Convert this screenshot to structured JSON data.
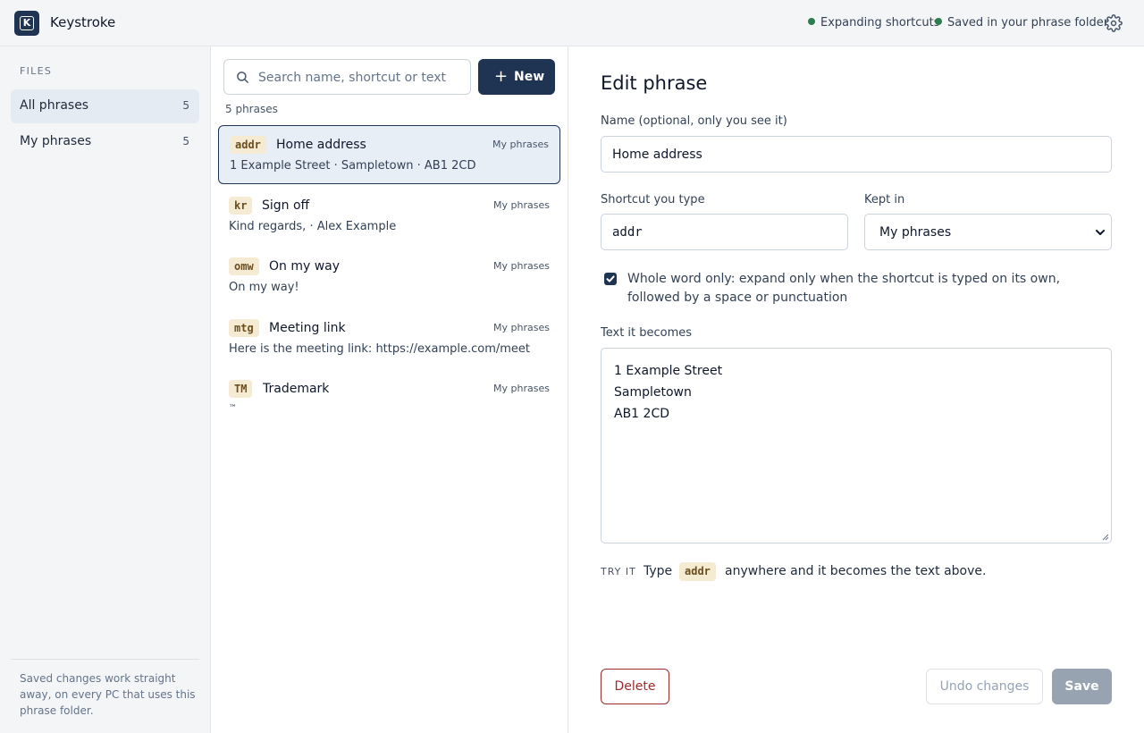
{
  "app": {
    "title": "Keystroke",
    "logo_letter": "K"
  },
  "status": {
    "expanding": "Expanding shortcuts",
    "saved": "Saved in your phrase folder",
    "dot_color": "#2f7d4f"
  },
  "sidebar": {
    "heading": "FILES",
    "items": [
      {
        "label": "All phrases",
        "count": "5",
        "active": true
      },
      {
        "label": "My phrases",
        "count": "5",
        "active": false
      }
    ],
    "note": "Saved changes work straight away, on every PC that uses this phrase folder."
  },
  "list": {
    "search_placeholder": "Search name, shortcut or text",
    "new_label": "New",
    "count_text": "5 phrases",
    "items": [
      {
        "code": "addr",
        "name": "Home address",
        "folder": "My phrases",
        "preview": "1 Example Street · Sampletown · AB1 2CD",
        "selected": true
      },
      {
        "code": "kr",
        "name": "Sign off",
        "folder": "My phrases",
        "preview": "Kind regards, · Alex Example",
        "selected": false
      },
      {
        "code": "omw",
        "name": "On my way",
        "folder": "My phrases",
        "preview": "On my way!",
        "selected": false
      },
      {
        "code": "mtg",
        "name": "Meeting link",
        "folder": "My phrases",
        "preview": "Here is the meeting link: https://example.com/meet",
        "selected": false
      },
      {
        "code": "TM",
        "name": "Trademark",
        "folder": "My phrases",
        "preview": "™",
        "selected": false
      }
    ]
  },
  "editor": {
    "heading": "Edit phrase",
    "name_label": "Name (optional, only you see it)",
    "name_value": "Home address",
    "shortcut_label": "Shortcut you type",
    "shortcut_value": "addr",
    "kept_label": "Kept in",
    "kept_value": "My phrases",
    "whole_word_checked": true,
    "whole_word_text": "Whole word only: expand only when the shortcut is typed on its own, followed by a space or punctuation",
    "text_label": "Text it becomes",
    "text_lines": [
      "1 Example Street",
      "Sampletown",
      "AB1 2CD"
    ],
    "tryit_label": "TRY IT",
    "tryit_prefix": "Type",
    "tryit_code": "addr",
    "tryit_suffix": "anywhere and it becomes the text above.",
    "delete_label": "Delete",
    "undo_label": "Undo changes",
    "save_label": "Save"
  },
  "colors": {
    "accent": "#1f3352",
    "danger": "#9b2c2c",
    "code_bg": "#f5ead2"
  }
}
